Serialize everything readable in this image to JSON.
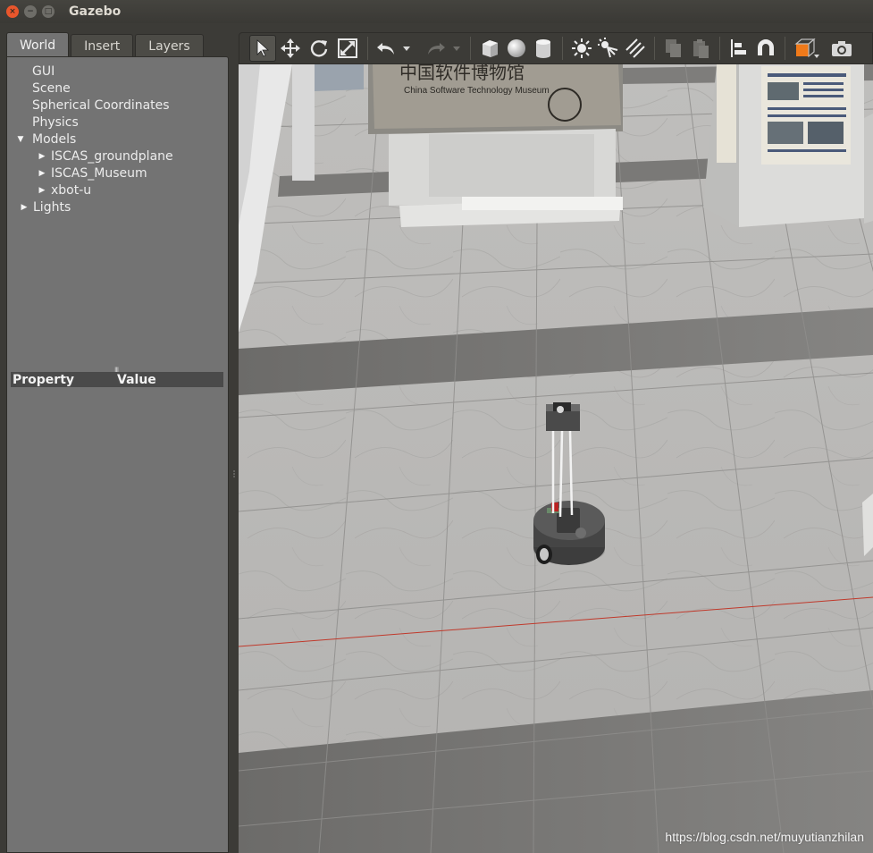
{
  "window": {
    "title": "Gazebo",
    "close_glyph": "×",
    "min_glyph": "−",
    "max_glyph": "□"
  },
  "left_panel": {
    "tabs": [
      {
        "label": "World",
        "active": true
      },
      {
        "label": "Insert",
        "active": false
      },
      {
        "label": "Layers",
        "active": false
      }
    ],
    "tree": {
      "gui": "GUI",
      "scene": "Scene",
      "spherical_coordinates": "Spherical Coordinates",
      "physics": "Physics",
      "models": "Models",
      "models_children": [
        "ISCAS_groundplane",
        "ISCAS_Museum",
        "xbot-u"
      ],
      "lights": "Lights"
    },
    "property_table": {
      "col_property": "Property",
      "col_value": "Value"
    }
  },
  "toolbar": {
    "icons": [
      "select-arrow-icon",
      "translate-icon",
      "rotate-icon",
      "scale-icon",
      "undo-icon",
      "undo-dropdown-icon",
      "redo-icon",
      "redo-dropdown-icon",
      "box-shape-icon",
      "sphere-shape-icon",
      "cylinder-shape-icon",
      "point-light-icon",
      "spot-light-icon",
      "directional-light-icon",
      "copy-icon",
      "paste-icon",
      "align-icon",
      "snap-icon",
      "view-angle-icon",
      "screenshot-icon"
    ]
  },
  "viewport": {
    "scene": "Simulated museum hall with marble floor tiles, exhibit panels and an xbot-u robot",
    "sign_cn": "中国软件博物馆",
    "sign_en": "China Software Technology Museum",
    "watermark": "https://blog.csdn.net/muyutianzhilan"
  },
  "colors": {
    "window_bg": "#3c3b37",
    "panel_bg": "#737373",
    "close_button": "#e9562c",
    "accent_orange": "#f07a1a",
    "floor_light": "#c9c8c6",
    "floor_dark": "#7e7d7b",
    "axis_red": "#c0392b"
  }
}
